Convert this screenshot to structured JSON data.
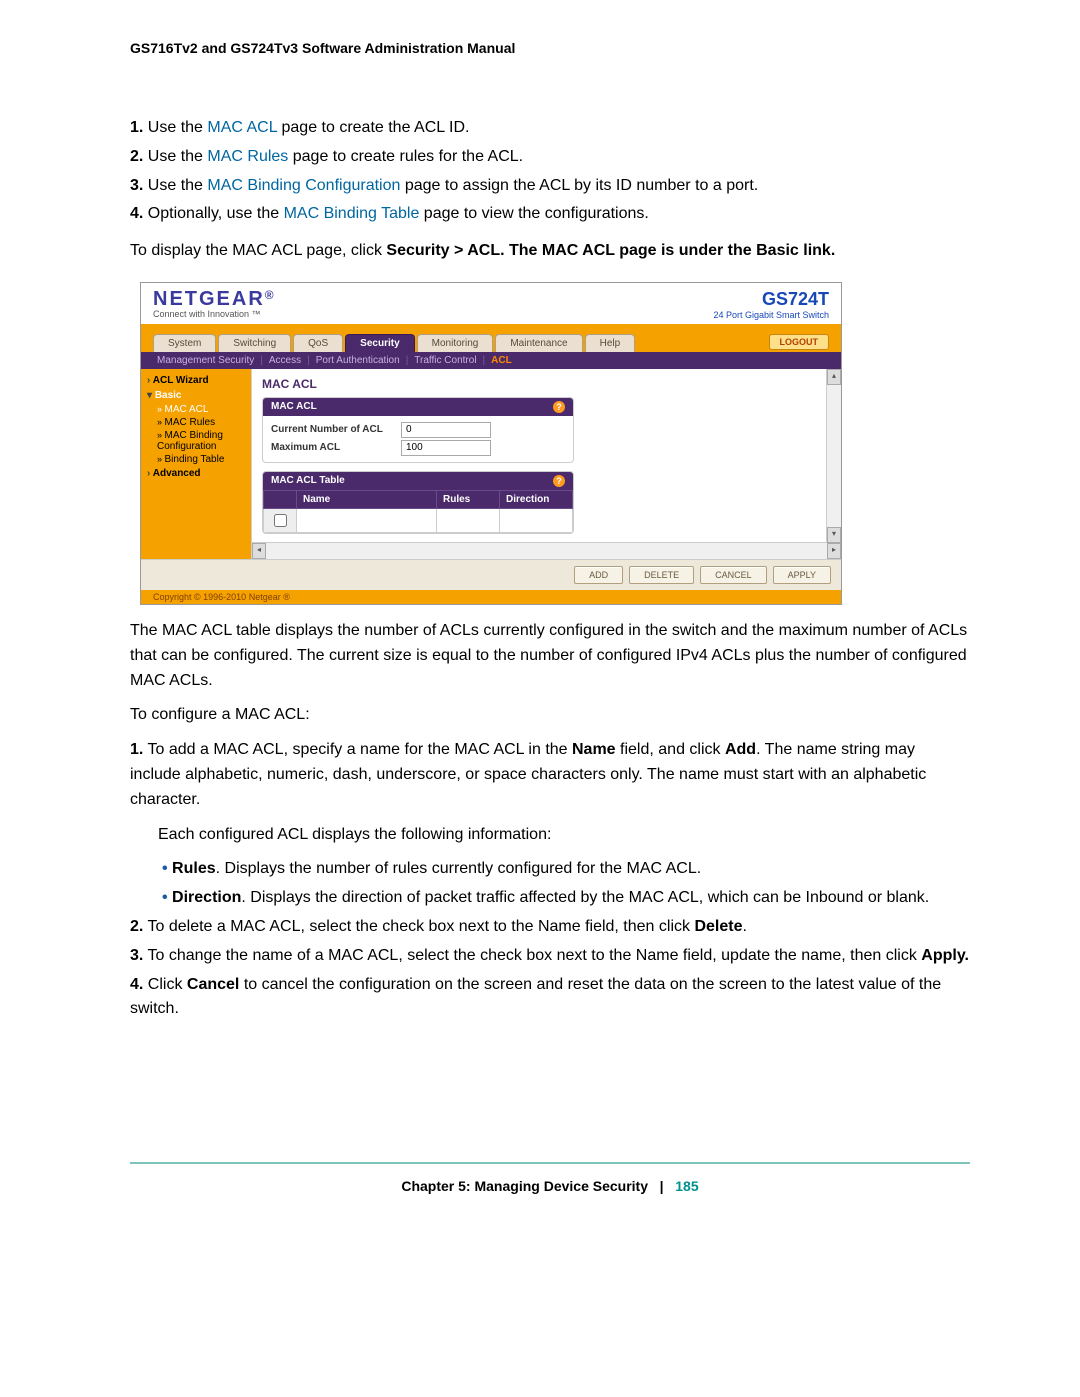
{
  "document": {
    "header": "GS716Tv2 and GS724Tv3 Software Administration Manual",
    "footer_chapter": "Chapter 5:  Managing Device Security",
    "footer_sep": "|",
    "page_number": "185"
  },
  "steps_top": {
    "s1n": "1.",
    "s1a": "Use the ",
    "s1link": "MAC ACL",
    "s1b": " page to create the ACL ID.",
    "s2n": "2.",
    "s2a": "Use the ",
    "s2link": "MAC Rules",
    "s2b": " page to create rules for the ACL.",
    "s3n": "3.",
    "s3a": "Use the ",
    "s3link": "MAC Binding Configuration",
    "s3b": " page to assign the ACL by its ID number to a port.",
    "s4n": "4.",
    "s4a": "Optionally, use the ",
    "s4link": "MAC Binding Table",
    "s4b": " page to view the configurations."
  },
  "intro_para_a": "To display the MAC ACL page, click ",
  "intro_para_b": "Security > ACL. The MAC ACL page is under the Basic link.",
  "screenshot": {
    "brand": "NETGEAR",
    "brand_trade": "®",
    "brand_tag": "Connect with Innovation ™",
    "model": "GS724T",
    "model_sub": "24 Port Gigabit Smart Switch",
    "tabs": [
      "System",
      "Switching",
      "QoS",
      "Security",
      "Monitoring",
      "Maintenance",
      "Help"
    ],
    "active_tab": "Security",
    "logout": "LOGOUT",
    "subtabs": [
      "Management Security",
      "Access",
      "Port Authentication",
      "Traffic Control",
      "ACL"
    ],
    "active_subtab": "ACL",
    "sidebar": {
      "g1": "ACL Wizard",
      "g2": "Basic",
      "items": [
        "MAC ACL",
        "MAC Rules",
        "MAC Binding Configuration",
        "Binding Table"
      ],
      "g3": "Advanced"
    },
    "section_title": "MAC ACL",
    "panel1": {
      "title": "MAC ACL",
      "row1_label": "Current Number of ACL",
      "row1_value": "0",
      "row2_label": "Maximum ACL",
      "row2_value": "100"
    },
    "panel2": {
      "title": "MAC ACL Table",
      "cols": [
        "Name",
        "Rules",
        "Direction"
      ]
    },
    "actions": [
      "ADD",
      "DELETE",
      "CANCEL",
      "APPLY"
    ],
    "copyright": "Copyright © 1996-2010 Netgear ®"
  },
  "after": {
    "p1": "The MAC ACL table displays the number of ACLs currently configured in the switch and the maximum number of ACLs that can be configured. The current size is equal to the number of configured IPv4 ACLs plus the number of configured MAC ACLs.",
    "p2": "To configure a MAC ACL:",
    "s1n": "1.",
    "s1a": "To add a MAC ACL, specify a name for the MAC ACL in the ",
    "s1b": "Name",
    "s1c": " field, and click ",
    "s1d": "Add",
    "s1e": ". The name string may include alphabetic, numeric, dash, underscore, or space characters only. The name must start with an alphabetic character.",
    "s1f": "Each configured ACL displays the following information:",
    "b1a": "Rules",
    "b1b": ". Displays the number of rules currently configured for the MAC ACL.",
    "b2a": "Direction",
    "b2b": ". Displays the direction of packet traffic affected by the MAC ACL, which can be Inbound or blank.",
    "s2n": "2.",
    "s2a": "To delete a MAC ACL, select the check box next to the Name field, then click ",
    "s2b": "Delete",
    "s2c": ".",
    "s3n": "3.",
    "s3a": "To change the name of a MAC ACL, select the check box next to the Name field, update the name, then click ",
    "s3b": "Apply.",
    "s4n": "4.",
    "s4a": "Click ",
    "s4b": "Cancel",
    "s4c": " to cancel the configuration on the screen and reset the data on the screen to the latest value of the switch."
  }
}
